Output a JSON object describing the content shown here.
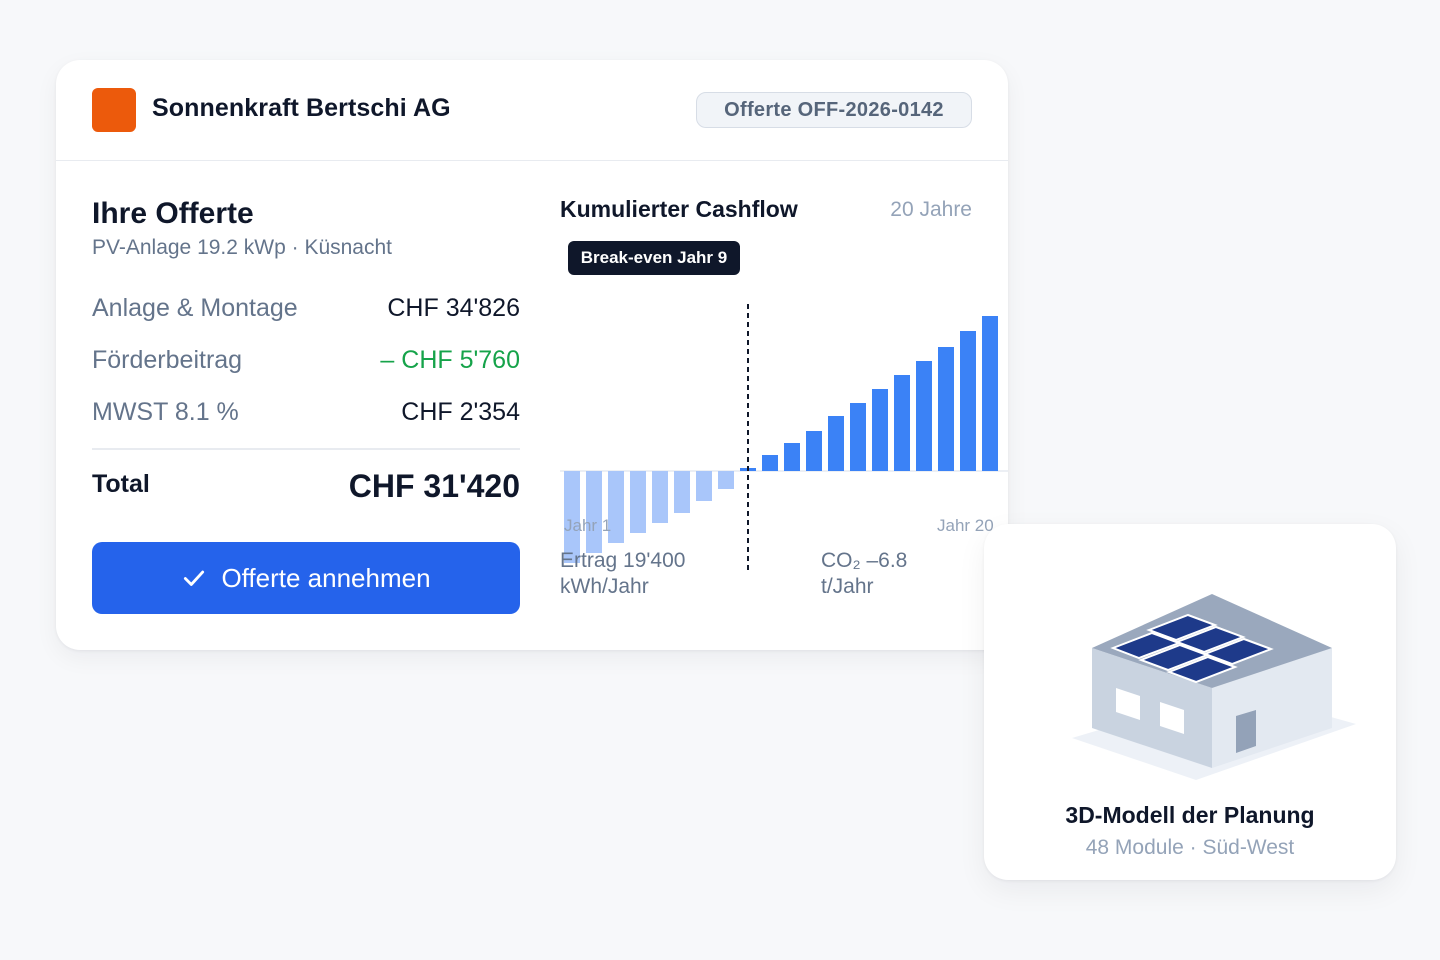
{
  "header": {
    "company": "Sonnenkraft Bertschi AG",
    "offer_badge": "Offerte OFF-2026-0142"
  },
  "offer": {
    "title": "Ihre Offerte",
    "subtitle": "PV-Anlage 19.2 kWp · Küsnacht",
    "items": [
      {
        "label": "Anlage & Montage",
        "value": "CHF 34'826"
      },
      {
        "label": "Förderbeitrag",
        "value": "– CHF 5'760"
      },
      {
        "label": "MWST 8.1 %",
        "value": "CHF 2'354"
      }
    ],
    "total_label": "Total",
    "total_value": "CHF 31'420",
    "accept_label": "Offerte annehmen"
  },
  "cashflow": {
    "title": "Kumulierter Cashflow",
    "range_label": "20 Jahre",
    "break_even_label": "Break-even Jahr 9",
    "axis_start": "Jahr 1",
    "axis_end": "Jahr 20",
    "yield": "Ertrag 19'400 kWh/Jahr",
    "co2": "CO₂ –6.8 t/Jahr"
  },
  "colors": {
    "brand": "#ec5a0c",
    "accent": "#2563eb",
    "positive": "#16a34a",
    "bar_positive": "#3b82f6",
    "bar_negative": "#a9c6fa"
  },
  "chart_data": {
    "type": "bar",
    "x": [
      1,
      2,
      3,
      4,
      5,
      6,
      7,
      8,
      9,
      10,
      11,
      12,
      13,
      14,
      15,
      16,
      17,
      18,
      19,
      20
    ],
    "values": [
      -92,
      -82,
      -72,
      -62,
      -52,
      -42,
      -30,
      -18,
      3,
      16,
      28,
      40,
      55,
      68,
      82,
      96,
      110,
      124,
      140,
      155
    ],
    "break_even_year": 9,
    "title": "Kumulierter Cashflow",
    "xlabel": "",
    "ylabel": "",
    "ylim": [
      -105,
      160
    ],
    "grid": false
  },
  "model": {
    "title": "3D-Modell der Planung",
    "subtitle": "48 Module · Süd-West"
  }
}
